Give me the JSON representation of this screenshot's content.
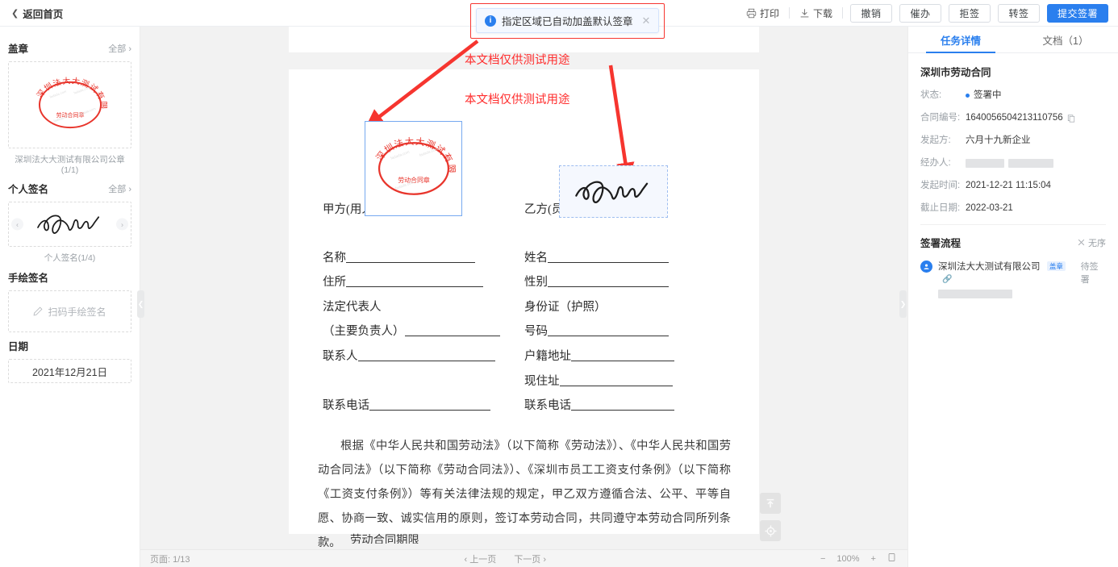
{
  "topbar": {
    "back_label": "返回首页",
    "print_label": "打印",
    "download_label": "下载",
    "buttons": [
      {
        "label": "撤销"
      },
      {
        "label": "催办"
      },
      {
        "label": "拒签"
      },
      {
        "label": "转签"
      }
    ],
    "submit_label": "提交签署"
  },
  "toast": {
    "message": "指定区域已自动加盖默认签章",
    "info_glyph": "i",
    "close_glyph": "✕",
    "highlight_color": "#f6352f"
  },
  "sidebar": {
    "seal_section": {
      "title": "盖章",
      "all_label": "全部",
      "seal_outer_text": "深圳法大大测试有限公司",
      "seal_inner_text": "劳动合同章",
      "caption": "深圳法大大测试有限公司公章(1/1)"
    },
    "signature_section": {
      "title": "个人签名",
      "all_label": "全部",
      "caption": "个人签名(1/4)",
      "prev_glyph": "‹",
      "next_glyph": "›"
    },
    "draw_section": {
      "title": "手绘签名",
      "placeholder": "扫码手绘签名"
    },
    "date_section": {
      "title": "日期",
      "value": "2021年12月21日"
    }
  },
  "document": {
    "watermark_top": "本文档仅供测试用途",
    "watermark_second": "本文档仅供测试用途",
    "left_column": [
      "甲方(用人单位)",
      "名称",
      "住所",
      "法定代表人",
      "（主要负责人）",
      "联系人",
      "联系电话"
    ],
    "right_column": [
      "乙方(员工)",
      "姓名",
      "性别",
      "身份证（护照）",
      "号码",
      "户籍地址",
      "现住址",
      "联系电话"
    ],
    "paragraph": "根据《中华人民共和国劳动法》（以下简称《劳动法》）、《中华人民共和国劳动合同法》（以下简称《劳动合同法》）、《深圳市员工工资支付条例》（以下简称《工资支付条例》）等有关法律法规的规定，甲乙双方遵循合法、公平、平等自愿、协商一致、诚实信用的原则，签订本劳动合同，共同遵守本劳动合同所列条款。",
    "next_heading": "劳动合同期限",
    "seal_slot_outer": "深圳法大大测试有限公司",
    "seal_slot_inner": "劳动合同章"
  },
  "float_buttons": {
    "top_label": "scroll-to-top",
    "locate_label": "locate"
  },
  "bottombar": {
    "page_label": "页面: 1/13",
    "prev_page": "上一页",
    "next_page": "下一页",
    "prev_glyph": "‹",
    "next_glyph": "›",
    "zoom_out": "−",
    "zoom_value": "100%",
    "zoom_in": "+"
  },
  "right_panel": {
    "tabs": [
      {
        "label": "任务详情",
        "active": true
      },
      {
        "label": "文档（1）",
        "active": false
      }
    ],
    "doc_title": "深圳市劳动合同",
    "fields": [
      {
        "key": "状态:",
        "value": "签署中"
      },
      {
        "key": "合同编号:",
        "value": "1640056504213110756"
      },
      {
        "key": "发起方:",
        "value": "六月十九新企业"
      },
      {
        "key": "经办人:",
        "value": ""
      },
      {
        "key": "发起时间:",
        "value": "2021-12-21 11:15:04"
      },
      {
        "key": "截止日期:",
        "value": "2022-03-21"
      }
    ],
    "flow": {
      "title": "签署流程",
      "order_label": "无序",
      "participant": "深圳法大大测试有限公司",
      "badge": "盖章",
      "status": "待签署"
    }
  }
}
